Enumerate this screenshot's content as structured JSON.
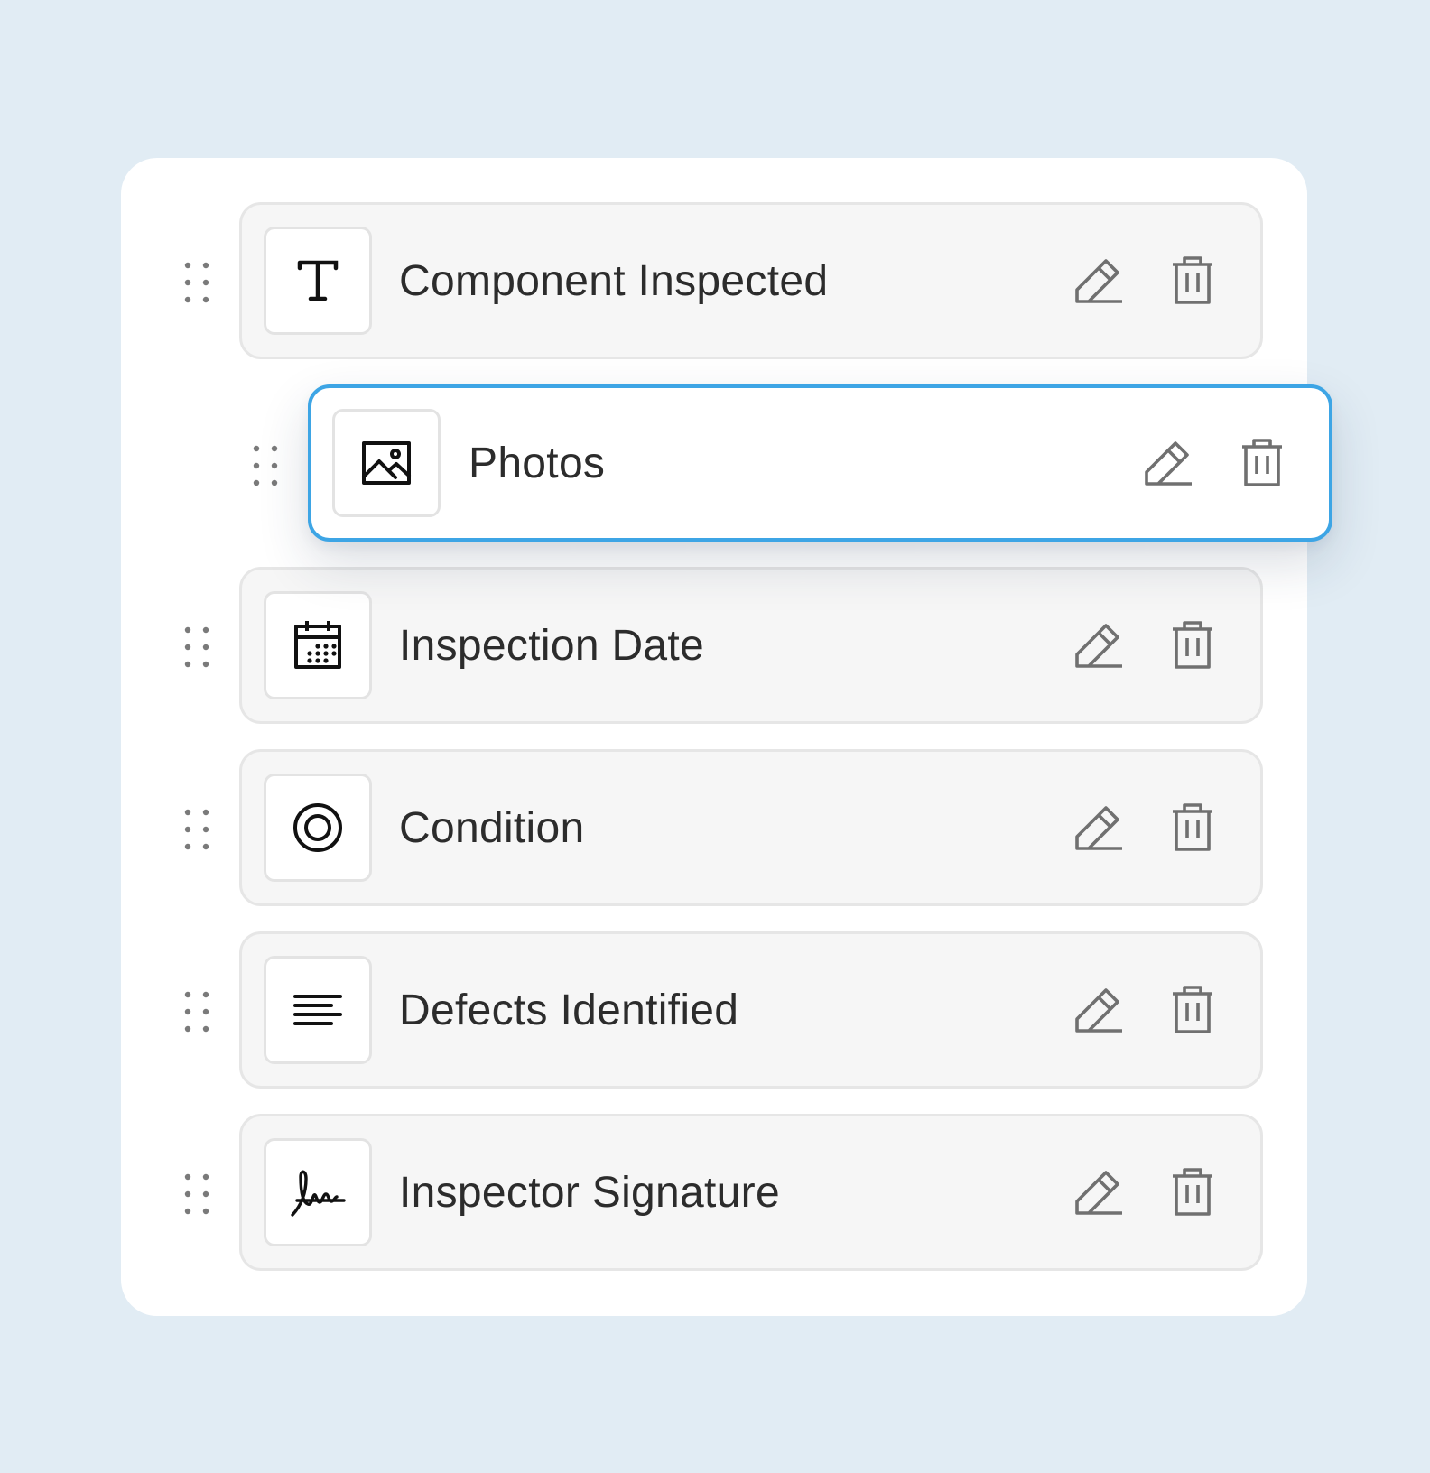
{
  "fields": [
    {
      "label": "Component Inspected",
      "type_icon": "text-type-icon"
    },
    {
      "label": "Photos",
      "type_icon": "image-icon",
      "state": "dragging"
    },
    {
      "label": "Inspection Date",
      "type_icon": "calendar-icon"
    },
    {
      "label": "Condition",
      "type_icon": "radio-icon"
    },
    {
      "label": "Defects Identified",
      "type_icon": "paragraph-icon"
    },
    {
      "label": "Inspector Signature",
      "type_icon": "signature-icon"
    }
  ],
  "actions": {
    "edit_icon": "pencil-icon",
    "delete_icon": "trash-icon"
  },
  "colors": {
    "background": "#e1ecf4",
    "panel": "#ffffff",
    "row": "#f6f6f6",
    "drag_border": "#3da5e5",
    "text": "#2c2c2c",
    "icon_muted": "#707070"
  }
}
